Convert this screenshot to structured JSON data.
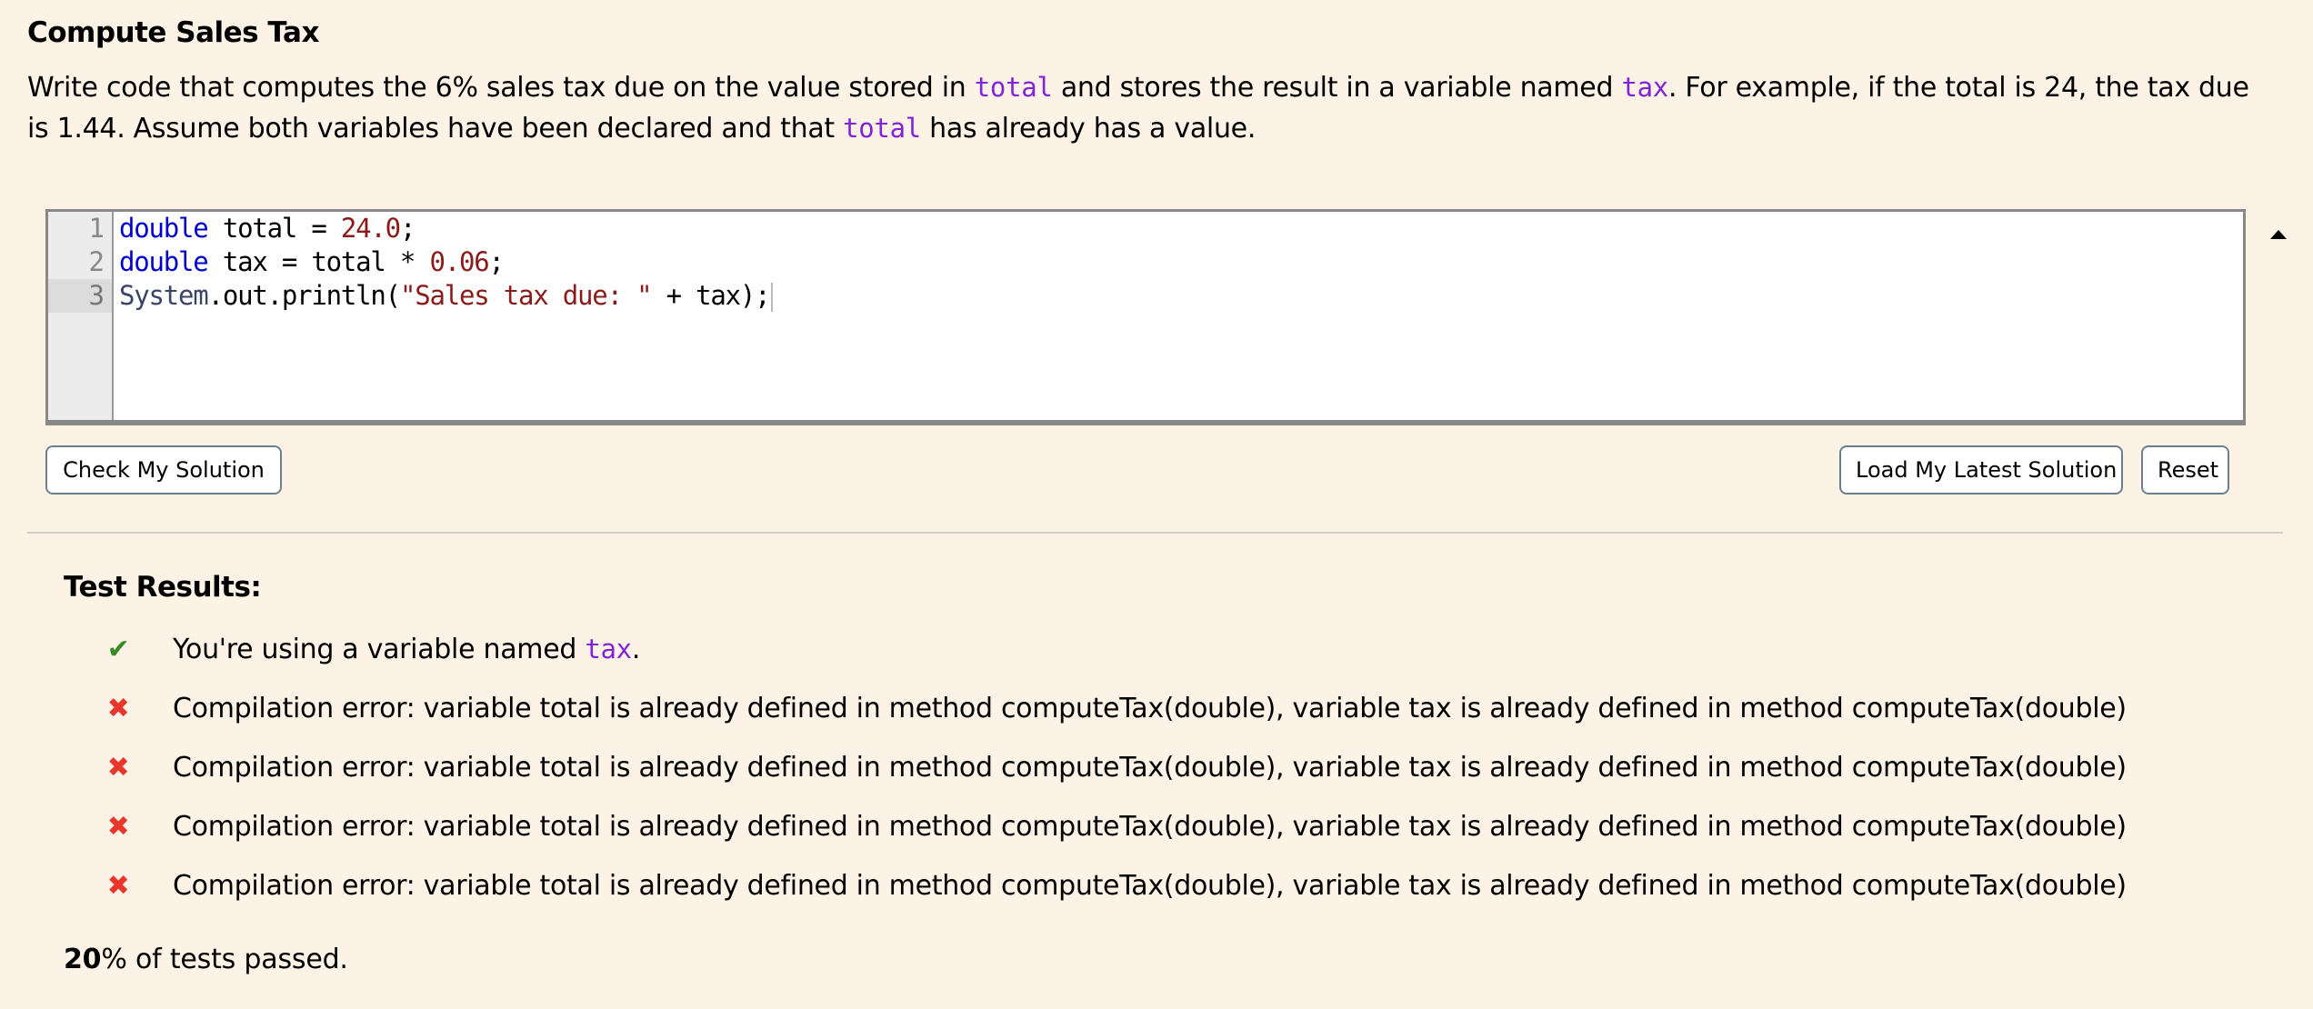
{
  "problem": {
    "title": "Compute Sales Tax",
    "description": {
      "part1": "Write code that computes the 6% sales tax due on the value stored in ",
      "var1": "total",
      "part2": " and stores the result in a variable named ",
      "var2": "tax",
      "part3": ". For example, if the total is 24, the tax due is 1.44. Assume both variables have been declared and that ",
      "var3": "total",
      "part4": " has already has a value."
    }
  },
  "editor": {
    "active_line": 3,
    "line_numbers": [
      "1",
      "2",
      "3"
    ],
    "lines": [
      {
        "tokens": [
          {
            "t": "double",
            "c": "kw"
          },
          {
            "t": " total = ",
            "c": ""
          },
          {
            "t": "24.0",
            "c": "num"
          },
          {
            "t": ";",
            "c": ""
          }
        ]
      },
      {
        "tokens": [
          {
            "t": "double",
            "c": "kw"
          },
          {
            "t": " tax = total * ",
            "c": ""
          },
          {
            "t": "0.06",
            "c": "num"
          },
          {
            "t": ";",
            "c": ""
          }
        ]
      },
      {
        "tokens": [
          {
            "t": "System",
            "c": "cls"
          },
          {
            "t": ".out.println(",
            "c": ""
          },
          {
            "t": "\"Sales tax due: \"",
            "c": "str"
          },
          {
            "t": " + tax);",
            "c": ""
          }
        ]
      }
    ]
  },
  "buttons": {
    "check": "Check My Solution",
    "load": "Load My Latest Solution",
    "reset": "Reset"
  },
  "results": {
    "title": "Test Results:",
    "items": [
      {
        "status": "pass",
        "icon": "✔",
        "text": "You're using a variable named ",
        "code": "tax",
        "suffix": "."
      },
      {
        "status": "fail",
        "icon": "✖",
        "text": "Compilation error: variable total is already defined in method computeTax(double), variable tax is already defined in method computeTax(double)"
      },
      {
        "status": "fail",
        "icon": "✖",
        "text": "Compilation error: variable total is already defined in method computeTax(double), variable tax is already defined in method computeTax(double)"
      },
      {
        "status": "fail",
        "icon": "✖",
        "text": "Compilation error: variable total is already defined in method computeTax(double), variable tax is already defined in method computeTax(double)"
      },
      {
        "status": "fail",
        "icon": "✖",
        "text": "Compilation error: variable total is already defined in method computeTax(double), variable tax is already defined in method computeTax(double)"
      }
    ],
    "summary_percent": "20",
    "summary_text": "% of tests passed."
  },
  "colors": {
    "background": "#fcf3e6",
    "code_var": "#8224d6",
    "pass": "#3a8a2a",
    "fail": "#e8372a",
    "keyword": "#0000cc",
    "literal": "#8b1a1a"
  }
}
